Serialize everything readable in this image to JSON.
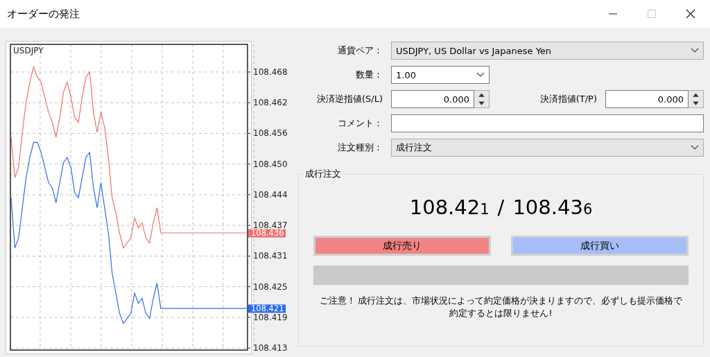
{
  "window": {
    "title": "オーダーの発注",
    "controls": [
      {
        "kind": "minimize",
        "disabled": false
      },
      {
        "kind": "maximize",
        "disabled": true
      },
      {
        "kind": "close",
        "disabled": false
      }
    ]
  },
  "chart": {
    "chart_data": {
      "type": "line",
      "title": "USDJPY",
      "grid": true,
      "ylim": [
        108.4127,
        108.4735
      ],
      "yticks": [
        {
          "value": 108.468,
          "label": "108.468"
        },
        {
          "value": 108.4619,
          "label": "108.462"
        },
        {
          "value": 108.4558,
          "label": "108.456"
        },
        {
          "value": 108.4497,
          "label": "108.450"
        },
        {
          "value": 108.4436,
          "label": "108.444"
        },
        {
          "value": 108.4375,
          "label": "108.437"
        },
        {
          "value": 108.4314,
          "label": "108.431"
        },
        {
          "value": 108.4253,
          "label": "108.425"
        },
        {
          "value": 108.4192,
          "label": "108.419"
        },
        {
          "value": 108.4131,
          "label": "108.413"
        }
      ],
      "series": [
        {
          "color": "#f07070",
          "values": [
            108.455,
            108.447,
            108.449,
            108.456,
            108.462,
            108.466,
            108.469,
            108.467,
            108.466,
            108.463,
            108.46,
            108.458,
            108.455,
            108.459,
            108.464,
            108.466,
            108.463,
            108.459,
            108.458,
            108.463,
            108.467,
            108.468,
            108.46,
            108.456,
            108.46,
            108.457,
            108.451,
            108.443,
            108.44,
            108.436,
            108.433,
            108.434,
            108.435,
            108.439,
            108.437,
            108.438,
            108.435,
            108.434,
            108.438,
            108.441,
            108.436,
            108.436,
            108.436,
            108.436,
            108.436,
            108.436,
            108.436,
            108.436,
            108.436,
            108.436,
            108.436,
            108.436,
            108.436,
            108.436,
            108.436,
            108.436,
            108.436,
            108.436,
            108.436,
            108.436,
            108.436,
            108.436,
            108.436,
            108.436
          ]
        },
        {
          "color": "#2e6bf0",
          "values": [
            108.443,
            108.433,
            108.435,
            108.441,
            108.447,
            108.451,
            108.454,
            108.454,
            108.452,
            108.449,
            108.446,
            108.445,
            108.442,
            108.446,
            108.45,
            108.451,
            108.449,
            108.444,
            108.443,
            108.447,
            108.451,
            108.452,
            108.445,
            108.441,
            108.446,
            108.441,
            108.436,
            108.428,
            108.424,
            108.42,
            108.418,
            108.419,
            108.42,
            108.424,
            108.422,
            108.423,
            108.42,
            108.419,
            108.423,
            108.426,
            108.421,
            108.421,
            108.421,
            108.421,
            108.421,
            108.421,
            108.421,
            108.421,
            108.421,
            108.421,
            108.421,
            108.421,
            108.421,
            108.421,
            108.421,
            108.421,
            108.421,
            108.421,
            108.421,
            108.421,
            108.421,
            108.421,
            108.421,
            108.421
          ]
        }
      ]
    },
    "price_tags": [
      {
        "label": "108.436",
        "color": "#f07070"
      },
      {
        "label": "108.421",
        "color": "#2e6bf0"
      }
    ]
  },
  "form": {
    "rows": [
      {
        "fields": [
          {
            "label": "通貨ペア：",
            "kind": "combo",
            "value": "USDJPY, US Dollar vs Japanese Yen",
            "disabled": true
          }
        ]
      },
      {
        "fields": [
          {
            "label": "数量：",
            "kind": "dropdown",
            "value": "1.00",
            "disabled": false
          }
        ]
      },
      {
        "fields": [
          {
            "label": "決済逆指値(S/L)",
            "kind": "spinner",
            "value": "0.000",
            "disabled": false
          },
          {
            "label": "決済指値(T/P)",
            "kind": "spinner",
            "value": "0.000",
            "disabled": false
          }
        ]
      },
      {
        "fields": [
          {
            "label": "コメント：",
            "kind": "text",
            "disabled": false
          }
        ]
      },
      {
        "fields": [
          {
            "label": "注文種別：",
            "kind": "combo",
            "value": "成行注文",
            "disabled": true
          }
        ]
      }
    ]
  },
  "order": {
    "title": "成行注文",
    "bid": {
      "main": "108.42",
      "pip": "1"
    },
    "separator": "/",
    "ask": {
      "main": "108.43",
      "pip": "6"
    },
    "buttons": [
      {
        "kind": "sell",
        "label": "成行売り"
      },
      {
        "kind": "buy",
        "label": "成行買い"
      }
    ],
    "warning": "ご注意！ 成行注文は、市場状況によって約定価格が決まりますので、必ずしも提示価格で約定するとは限りません!"
  }
}
